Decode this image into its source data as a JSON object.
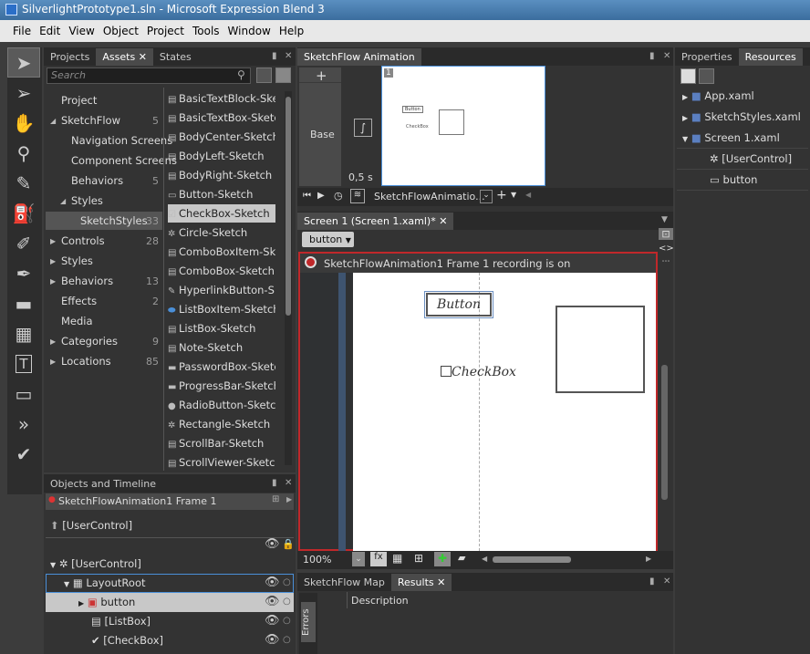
{
  "window": {
    "title": "SilverlightPrototype1.sln - Microsoft Expression Blend 3"
  },
  "menu": [
    "File",
    "Edit",
    "View",
    "Object",
    "Project",
    "Tools",
    "Window",
    "Help"
  ],
  "toolbox": [
    "selection-arrow",
    "direct-select",
    "pan-hand",
    "zoom",
    "eyedropper",
    "paint-bucket",
    "brush",
    "pen",
    "rectangle",
    "grid",
    "text",
    "button",
    "more",
    "sketch"
  ],
  "left_panel": {
    "tabs": [
      "Projects",
      "Assets",
      "States"
    ],
    "search_placeholder": "Search",
    "categories": [
      {
        "label": "Project",
        "count": ""
      },
      {
        "label": "SketchFlow",
        "count": "5"
      },
      {
        "label": "Navigation Screens",
        "count": ""
      },
      {
        "label": "Component Screens",
        "count": ""
      },
      {
        "label": "Behaviors",
        "count": "5"
      },
      {
        "label": "Styles",
        "count": ""
      },
      {
        "label": "SketchStyles",
        "count": "33"
      },
      {
        "label": "Controls",
        "count": "28"
      },
      {
        "label": "Styles",
        "count": ""
      },
      {
        "label": "Behaviors",
        "count": "13"
      },
      {
        "label": "Effects",
        "count": "2"
      },
      {
        "label": "Media",
        "count": ""
      },
      {
        "label": "Categories",
        "count": "9"
      },
      {
        "label": "Locations",
        "count": "85"
      }
    ],
    "assets": [
      "BasicTextBlock-Ske...",
      "BasicTextBox-Sketch",
      "BodyCenter-Sketch",
      "BodyLeft-Sketch",
      "BodyRight-Sketch",
      "Button-Sketch",
      "CheckBox-Sketch",
      "Circle-Sketch",
      "ComboBoxItem-Sk...",
      "ComboBox-Sketch",
      "HyperlinkButton-S...",
      "ListBoxItem-Sketch",
      "ListBox-Sketch",
      "Note-Sketch",
      "PasswordBox-Sketch",
      "ProgressBar-Sketch",
      "RadioButton-Sketch",
      "Rectangle-Sketch",
      "ScrollBar-Sketch",
      "ScrollViewer-Sketch"
    ],
    "selected_asset": "CheckBox-Sketch"
  },
  "objects_timeline": {
    "title": "Objects and Timeline",
    "frame": "SketchFlowAnimation1 Frame 1",
    "root": "[UserControl]",
    "tree": [
      "[UserControl]",
      "LayoutRoot",
      "button",
      "[ListBox]",
      "[CheckBox]"
    ]
  },
  "animation": {
    "title": "SketchFlow Animation",
    "base_label": "Base",
    "duration": "0,5 s",
    "frame_number": "1",
    "name": "SketchFlowAnimatio...",
    "thumb_button": "Button",
    "thumb_checkbox": "CheckBox"
  },
  "document": {
    "tab": "Screen 1 (Screen 1.xaml)*",
    "breadcrumb": "button",
    "recording": "SketchFlowAnimation1 Frame 1 recording is on",
    "button_text": "Button",
    "checkbox_text": "CheckBox",
    "zoom": "100%"
  },
  "bottom_panel": {
    "tabs": [
      "SketchFlow Map",
      "Results"
    ],
    "column": "Description",
    "side_tab": "Errors"
  },
  "right_panel": {
    "tabs": [
      "Properties",
      "Resources"
    ],
    "items": [
      "App.xaml",
      "SketchStyles.xaml",
      "Screen 1.xaml",
      "[UserControl]",
      "button"
    ]
  },
  "colors": {
    "recording_border": "#c0282a",
    "accent": "#4a8fd8"
  }
}
